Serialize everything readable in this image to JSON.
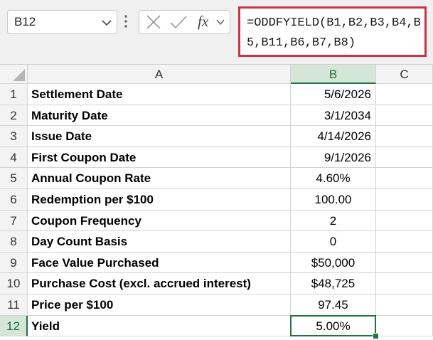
{
  "name_box": {
    "value": "B12"
  },
  "formula_bar": {
    "fx_label": "fx",
    "formula": "=ODDFYIELD(B1,B2,B3,B4,B5,B11,B6,B7,B8)"
  },
  "columns": [
    "A",
    "B",
    "C"
  ],
  "selected_cell": "B12",
  "rows": [
    {
      "num": "1",
      "label": "Settlement Date",
      "value": "5/6/2026",
      "align": "right"
    },
    {
      "num": "2",
      "label": "Maturity Date",
      "value": "3/1/2034",
      "align": "right"
    },
    {
      "num": "3",
      "label": "Issue Date",
      "value": "4/14/2026",
      "align": "right"
    },
    {
      "num": "4",
      "label": "First Coupon Date",
      "value": "9/1/2026",
      "align": "right"
    },
    {
      "num": "5",
      "label": "Annual Coupon Rate",
      "value": "4.60%",
      "align": "center"
    },
    {
      "num": "6",
      "label": "Redemption per $100",
      "value": "100.00",
      "align": "center"
    },
    {
      "num": "7",
      "label": "Coupon Frequency",
      "value": "2",
      "align": "center"
    },
    {
      "num": "8",
      "label": "Day Count Basis",
      "value": "0",
      "align": "center"
    },
    {
      "num": "9",
      "label": "Face Value Purchased",
      "value": "$50,000",
      "align": "center"
    },
    {
      "num": "10",
      "label": "Purchase Cost (excl. accrued interest)",
      "value": "$48,725",
      "align": "center"
    },
    {
      "num": "11",
      "label": "Price per $100",
      "value": "97.45",
      "align": "center"
    },
    {
      "num": "12",
      "label": "Yield",
      "value": "5.00%",
      "align": "center"
    }
  ],
  "colors": {
    "accent": "#217346",
    "formula_highlight": "#c8344a"
  }
}
